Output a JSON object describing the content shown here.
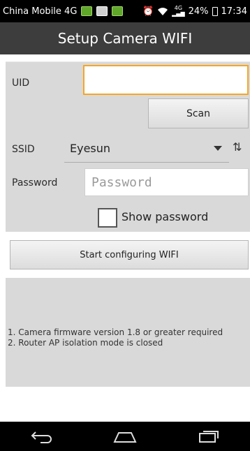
{
  "status_bar": {
    "carrier": "China Mobile 4G",
    "battery": "24%",
    "time": "17:34",
    "icons": [
      "notification-icon",
      "image-icon",
      "notification-icon",
      "alarm-icon",
      "wifi-icon",
      "signal-icon",
      "battery-icon"
    ],
    "signal_text": "4G"
  },
  "header": {
    "title": "Setup Camera WIFI"
  },
  "form": {
    "uid_label": "UID",
    "uid_value": "",
    "scan_label": "Scan",
    "ssid_label": "SSID",
    "ssid_value": "Eyesun",
    "password_label": "Password",
    "password_placeholder": "Password",
    "show_password_label": "Show password",
    "show_password_checked": false
  },
  "actions": {
    "start_label": "Start configuring WIFI"
  },
  "info": {
    "line1": "1. Camera firmware version 1.8 or greater required",
    "line2": "2. Router AP isolation mode is closed"
  },
  "nav": {
    "icons": [
      "back-icon",
      "home-icon",
      "recent-apps-icon"
    ]
  },
  "colors": {
    "accent": "#f5a623",
    "title_bar": "#3d3d3d",
    "panel": "#d9d9d9"
  }
}
